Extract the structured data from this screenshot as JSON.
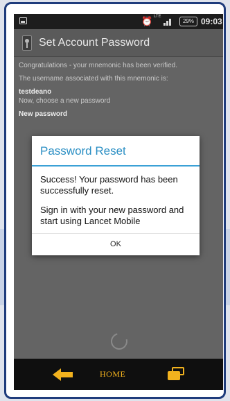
{
  "status_bar": {
    "battery": "29%",
    "time": "09:03",
    "network": "LTE"
  },
  "action_bar": {
    "title": "Set Account Password"
  },
  "content": {
    "line1": "Congratulations - your mnemonic has been verified.",
    "line2": "The username associated with this mnemonic is:",
    "username": "testdeano",
    "line3": "Now, choose a new password",
    "new_password_label": "New password"
  },
  "dialog": {
    "title": "Password Reset",
    "message1": "Success! Your password has been successfully reset.",
    "message2": "Sign in with your new password and start using Lancet Mobile",
    "ok_label": "OK"
  },
  "nav_bar": {
    "home_label": "HOME"
  },
  "colors": {
    "dialog_title": "#2b8fc4",
    "nav_accent": "#f2b21e",
    "frame_border": "#1f3c7c"
  }
}
